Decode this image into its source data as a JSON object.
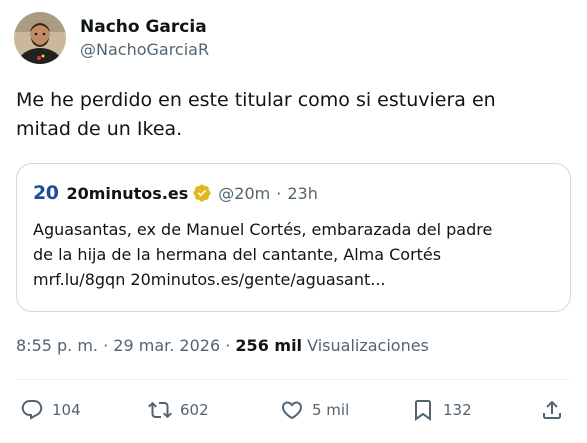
{
  "author": {
    "display_name": "Nacho Garcia",
    "handle": "@NachoGarciaR",
    "avatar_icon": "person-avatar-icon"
  },
  "tweet": {
    "line1": "Me he perdido en este titular como si estuviera en",
    "line2": "mitad de un Ikea."
  },
  "quote": {
    "logo": "20",
    "name": "20minutos.es",
    "verified_icon": "gold-verified-badge-icon",
    "handle": "@20m",
    "separator": "·",
    "time": "23h",
    "line1": "Aguasantas, ex de Manuel Cortés, embarazada del padre",
    "line2": "de la hija de la hermana del cantante, Alma Cortés",
    "line3": "mrf.lu/8gqn 20minutos.es/gente/aguasant..."
  },
  "meta": {
    "time": "8:55 p. m.",
    "sep1": "·",
    "date": "29 mar. 2026",
    "sep2": "·",
    "views_count": "256 mil",
    "views_label": "Visualizaciones"
  },
  "actions": {
    "replies": "104",
    "reposts": "602",
    "likes": "5 mil",
    "bookmarks": "132"
  },
  "colors": {
    "text": "#0f1419",
    "secondary": "#536471",
    "border": "#cfd9de",
    "brand_20m": "#1b4d9c",
    "verified_gold": "#e2b719"
  }
}
